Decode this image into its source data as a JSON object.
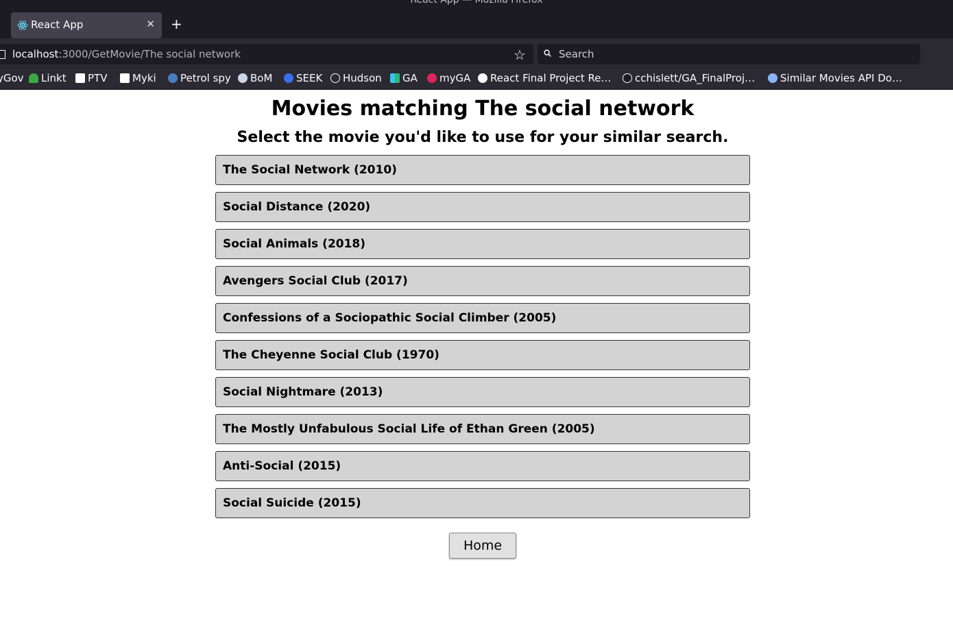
{
  "window": {
    "title": "React App — Mozilla Firefox"
  },
  "tab": {
    "title": "React App",
    "icon": "react-icon"
  },
  "urlbar": {
    "host": "localhost",
    "path": ":3000/GetMovie/The social network"
  },
  "search": {
    "placeholder": "Search"
  },
  "bookmarks": [
    {
      "label": "yGov",
      "icon": "gov-icon"
    },
    {
      "label": "Linkt",
      "icon": "linkt-icon"
    },
    {
      "label": "PTV",
      "icon": "ptv-icon"
    },
    {
      "label": "Myki",
      "icon": "myki-icon"
    },
    {
      "label": "Petrol spy",
      "icon": "petrolspy-icon"
    },
    {
      "label": "BoM",
      "icon": "bom-icon"
    },
    {
      "label": "SEEK",
      "icon": "seek-icon"
    },
    {
      "label": "Hudson",
      "icon": "globe-icon"
    },
    {
      "label": "GA",
      "icon": "slack-icon"
    },
    {
      "label": "myGA",
      "icon": "myga-icon"
    },
    {
      "label": "React Final Project Re…",
      "icon": "github-icon"
    },
    {
      "label": "cchislett/GA_FinalProj…",
      "icon": "github-icon"
    },
    {
      "label": "Similar Movies API Do…",
      "icon": "api-icon"
    }
  ],
  "page": {
    "heading": "Movies matching The social network",
    "subheading": "Select the movie you'd like to use for your similar search.",
    "movies": [
      "The Social Network (2010)",
      "Social Distance (2020)",
      "Social Animals (2018)",
      "Avengers Social Club (2017)",
      "Confessions of a Sociopathic Social Climber (2005)",
      "The Cheyenne Social Club (1970)",
      "Social Nightmare (2013)",
      "The Mostly Unfabulous Social Life of Ethan Green (2005)",
      "Anti-Social (2015)",
      "Social Suicide (2015)"
    ],
    "home_label": "Home"
  }
}
